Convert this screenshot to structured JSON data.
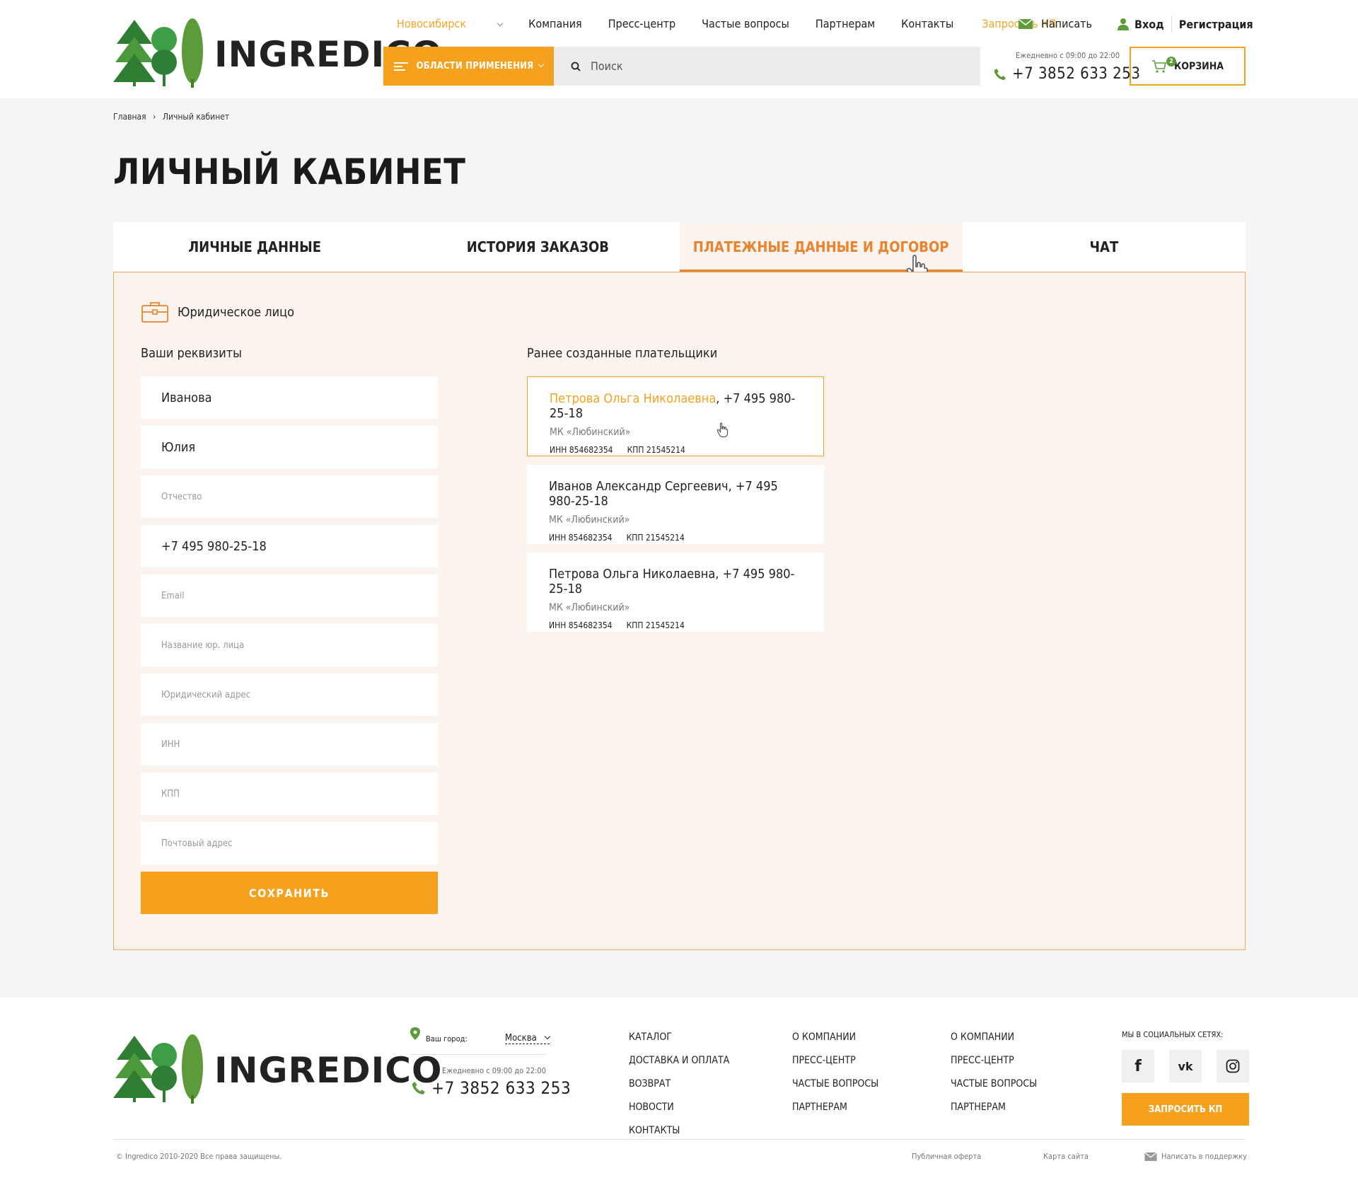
{
  "header": {
    "logo_text": "INGREDICO",
    "nav": {
      "city": "Новосибирск",
      "items": [
        "Компания",
        "Пресс-центр",
        "Частые вопросы",
        "Партнерам",
        "Контакты"
      ],
      "request_label": "Запросить КП"
    },
    "write_label": "Написать",
    "login_label": "Вход",
    "register_label": "Регистрация",
    "areas_label": "ОБЛАСТИ ПРИМЕНЕНИЯ",
    "search_placeholder": "Поиск",
    "hours": "Ежедневно с 09:00 до 22:00",
    "phone": "+7 3852 633 253",
    "cart_label": "КОРЗИНА",
    "cart_count": "2"
  },
  "breadcrumb": {
    "home": "Главная",
    "separator": "›",
    "current": "Личный кабинет"
  },
  "page_title": "ЛИЧНЫЙ КАБИНЕТ",
  "tabs": [
    {
      "label": "ЛИЧНЫЕ ДАННЫЕ",
      "active": false
    },
    {
      "label": "ИСТОРИЯ ЗАКАЗОВ",
      "active": false
    },
    {
      "label": "ПЛАТЕЖНЫЕ ДАННЫЕ И ДОГОВОР",
      "active": true
    },
    {
      "label": "ЧАТ",
      "active": false
    }
  ],
  "panel": {
    "entity_type": "Юридическое лицо",
    "requisites_title": "Ваши реквизиты",
    "fields": [
      {
        "value": "Иванова",
        "placeholder": ""
      },
      {
        "value": "Юлия",
        "placeholder": ""
      },
      {
        "value": "",
        "placeholder": "Отчество"
      },
      {
        "value": "+7 495 980-25-18",
        "placeholder": ""
      },
      {
        "value": "",
        "placeholder": "Email"
      },
      {
        "value": "",
        "placeholder": "Название юр. лица"
      },
      {
        "value": "",
        "placeholder": "Юридический адрес"
      },
      {
        "value": "",
        "placeholder": "ИНН"
      },
      {
        "value": "",
        "placeholder": "КПП"
      },
      {
        "value": "",
        "placeholder": "Почтовый адрес"
      }
    ],
    "save_label": "СОХРАНИТЬ",
    "payers_title": "Ранее созданные плательщики",
    "payers": [
      {
        "name": "Петрова Ольга Николаевна",
        "phone": ", +7 495 980-25-18",
        "org": "МК «Любинский»",
        "inn": "ИНН 854682354",
        "kpp": "КПП 21545214",
        "selected": true
      },
      {
        "name": "Иванов Александр Сергеевич",
        "phone": ", +7 495 980-25-18",
        "org": "МК «Любинский»",
        "inn": "ИНН 854682354",
        "kpp": "КПП 21545214",
        "selected": false
      },
      {
        "name": "Петрова Ольга Николаевна",
        "phone": ", +7 495 980-25-18",
        "org": "МК «Любинский»",
        "inn": "ИНН 854682354",
        "kpp": "КПП 21545214",
        "selected": false
      }
    ]
  },
  "footer": {
    "logo_text": "INGREDICO",
    "city_label": "Ваш город:",
    "city_value": "Москва",
    "hours": "Ежедневно с 09:00 до 22:00",
    "phone": "+7 3852 633 253",
    "col1": [
      "КАТАЛОГ",
      "ДОСТАВКА И ОПЛАТА",
      "ВОЗВРАТ",
      "НОВОСТИ",
      "КОНТАКТЫ"
    ],
    "col2": [
      "О КОМПАНИИ",
      "ПРЕСС-ЦЕНТР",
      "ЧАСТЫЕ ВОПРОСЫ",
      "ПАРТНЕРАМ"
    ],
    "col3": [
      "О КОМПАНИИ",
      "ПРЕСС-ЦЕНТР",
      "ЧАСТЫЕ ВОПРОСЫ",
      "ПАРТНЕРАМ"
    ],
    "social_label": "МЫ В СОЦИАЛЬНЫХ СЕТЯХ:",
    "social": {
      "facebook": "f",
      "vk": "vk"
    },
    "request_label": "ЗАПРОСИТЬ КП",
    "copyright": "© Ingredico 2010-2020 Все права защищены.",
    "offer": "Публичная оферта",
    "sitemap": "Карта сайта",
    "support": "Написать в поддержку"
  },
  "colors": {
    "accent": "#f5a11e",
    "accent_dark": "#e8832e",
    "green": "#5d9b3a",
    "panel_bg": "#fbf3ee"
  }
}
